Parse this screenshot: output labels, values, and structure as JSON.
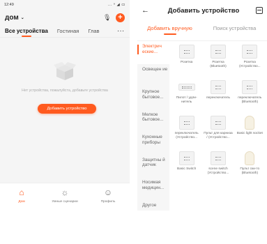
{
  "left": {
    "status": {
      "time": "12:49",
      "signal": "... ⁿ ◢ ▭"
    },
    "home": {
      "title": "дом",
      "chevron": "⌄"
    },
    "tabs": [
      "Все устройства",
      "Гостиная",
      "Глав"
    ],
    "tabs_more": "···",
    "empty_text": "Нет устройства, пожалуйста, добавьте устройства",
    "add_button": "Добавить устройство",
    "nav": [
      {
        "label": "Дом",
        "icon": "home-icon"
      },
      {
        "label": "Умные сценарии",
        "icon": "sun-icon"
      },
      {
        "label": "Профиль",
        "icon": "profile-icon"
      }
    ]
  },
  "right": {
    "back": "←",
    "title": "Добавить устройство",
    "tabs": {
      "manual": "Добавить вручную",
      "search": "Поиск устройства"
    },
    "categories": [
      "Электрич ескиe...",
      "Освещен ие",
      "Крупное бытовое...",
      "Мелкое бытовое...",
      "Кухонные приборы",
      "Защитны й датчик",
      "Носимая медицин...",
      "Другое"
    ],
    "devices": [
      {
        "name": "Розетка",
        "kind": "socket"
      },
      {
        "name": "Розетка (Bluetooth)",
        "kind": "socket"
      },
      {
        "name": "Розетка (Устройство...",
        "kind": "socket"
      },
      {
        "name": "Пилот / удли-нитель",
        "kind": "strip"
      },
      {
        "name": "переключатель",
        "kind": "switch"
      },
      {
        "name": "переключатель (Bluetooth)",
        "kind": "switch"
      },
      {
        "name": "переключатель (Устройство...",
        "kind": "switch"
      },
      {
        "name": "Пульт для карниза / (Устройство...",
        "kind": "switch"
      },
      {
        "name": "Basic light socket",
        "kind": "bulb"
      },
      {
        "name": "Basic Switch",
        "kind": "switch"
      },
      {
        "name": "scene switch (Устройство...",
        "kind": "switch"
      },
      {
        "name": "Пульт ски-то (Bluetooth)",
        "kind": "bulb"
      }
    ]
  },
  "colors": {
    "accent": "#ff5a1f"
  }
}
